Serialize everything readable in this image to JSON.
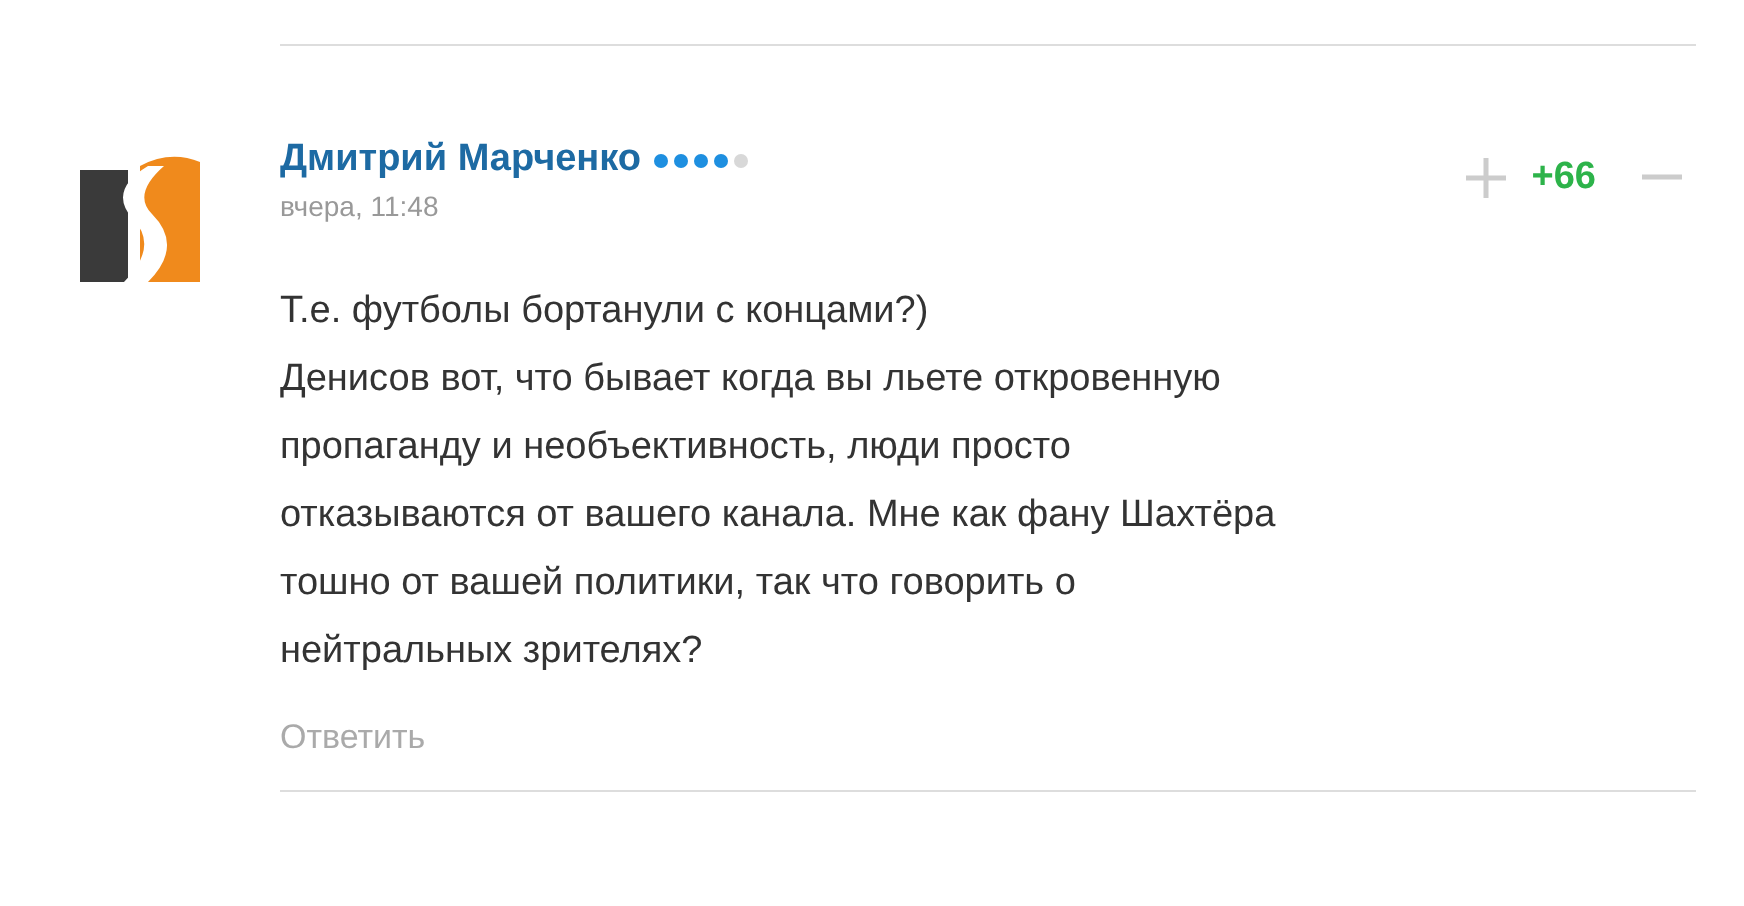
{
  "comment": {
    "author": "Дмитрий Марченко",
    "stars": 4,
    "time": "вчера, 11:48",
    "score": "+66",
    "lines": [
      "Т.е. футболы бортанули с концами?)",
      "Денисов вот, что бывает когда вы льете откровенную",
      "пропаганду и необъективность, люди просто",
      "отказываются от вашего канала. Мне как фану Шахтёра",
      "тошно от вашей политики, так что говорить о",
      "нейтральных зрителях?"
    ],
    "reply": "Ответить"
  }
}
